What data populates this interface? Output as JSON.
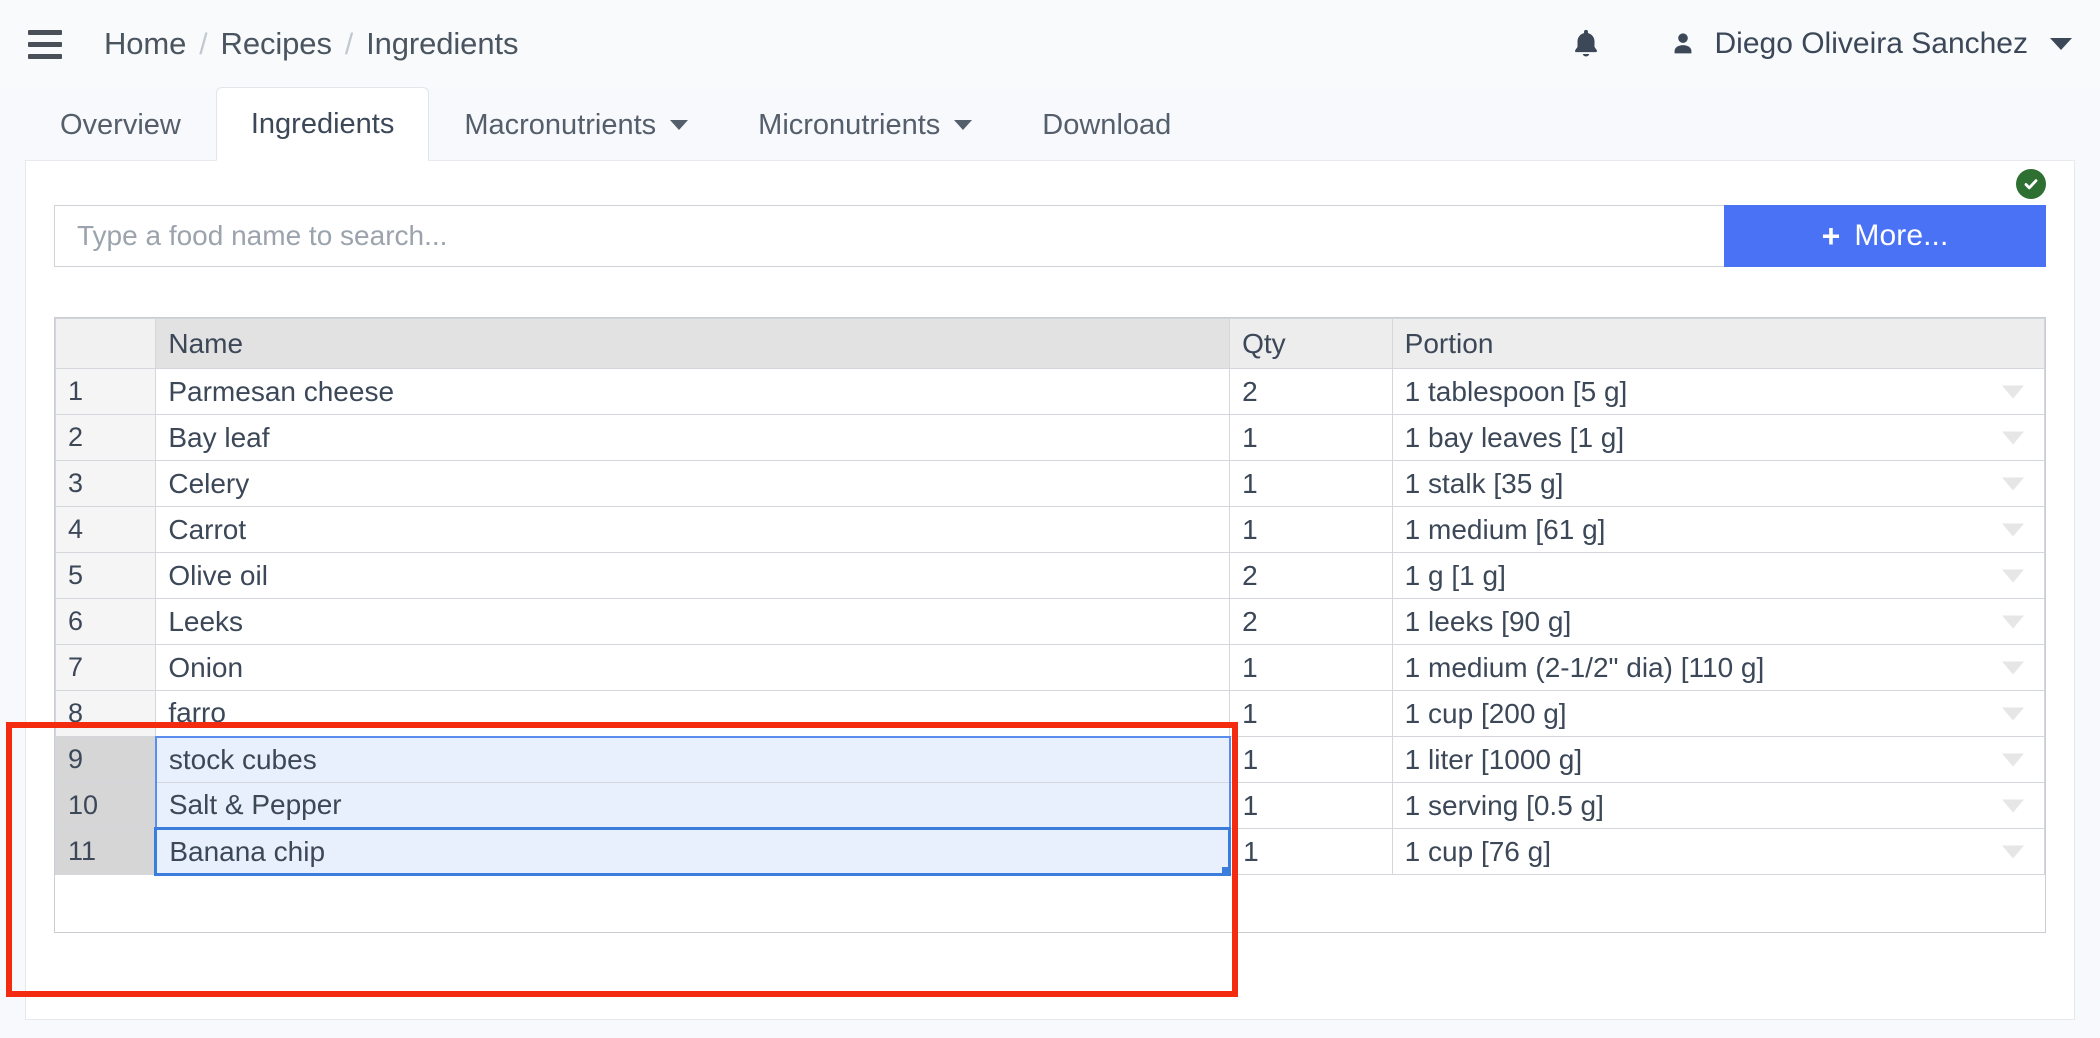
{
  "topbar": {
    "menu_icon": "hamburger-icon",
    "breadcrumb": [
      "Home",
      "Recipes",
      "Ingredients"
    ],
    "separator": "/",
    "notifications_icon": "bell-icon",
    "user_icon": "user-icon",
    "user_name": "Diego Oliveira Sanchez",
    "caret_icon": "chevron-down-icon"
  },
  "tabs": [
    {
      "label": "Overview",
      "active": false,
      "has_caret": false
    },
    {
      "label": "Ingredients",
      "active": true,
      "has_caret": false
    },
    {
      "label": "Macronutrients",
      "active": false,
      "has_caret": true
    },
    {
      "label": "Micronutrients",
      "active": false,
      "has_caret": true
    },
    {
      "label": "Download",
      "active": false,
      "has_caret": false
    }
  ],
  "status": {
    "icon": "check-circle-icon",
    "color": "#2e7031"
  },
  "search": {
    "placeholder": "Type a food name to search...",
    "value": "",
    "button_label": "More...",
    "button_plus": "+",
    "button_color": "#4a72f5"
  },
  "table": {
    "columns": [
      "",
      "Name",
      "Qty",
      "Portion"
    ],
    "rows": [
      {
        "idx": "1",
        "name": "Parmesan cheese",
        "qty": "2",
        "portion": "1 tablespoon [5 g]",
        "selected": false,
        "active": false
      },
      {
        "idx": "2",
        "name": "Bay leaf",
        "qty": "1",
        "portion": "1 bay leaves [1 g]",
        "selected": false,
        "active": false
      },
      {
        "idx": "3",
        "name": "Celery",
        "qty": "1",
        "portion": "1 stalk [35 g]",
        "selected": false,
        "active": false
      },
      {
        "idx": "4",
        "name": "Carrot",
        "qty": "1",
        "portion": "1 medium [61 g]",
        "selected": false,
        "active": false
      },
      {
        "idx": "5",
        "name": "Olive oil",
        "qty": "2",
        "portion": "1 g [1 g]",
        "selected": false,
        "active": false
      },
      {
        "idx": "6",
        "name": "Leeks",
        "qty": "2",
        "portion": "1 leeks [90 g]",
        "selected": false,
        "active": false
      },
      {
        "idx": "7",
        "name": "Onion",
        "qty": "1",
        "portion": "1 medium (2-1/2\" dia) [110 g]",
        "selected": false,
        "active": false
      },
      {
        "idx": "8",
        "name": "farro",
        "qty": "1",
        "portion": "1 cup [200 g]",
        "selected": false,
        "active": false
      },
      {
        "idx": "9",
        "name": "stock cubes",
        "qty": "1",
        "portion": "1 liter [1000 g]",
        "selected": true,
        "active": false
      },
      {
        "idx": "10",
        "name": "Salt & Pepper",
        "qty": "1",
        "portion": "1 serving [0.5 g]",
        "selected": true,
        "active": false
      },
      {
        "idx": "11",
        "name": "Banana chip",
        "qty": "1",
        "portion": "1 cup [76 g]",
        "selected": true,
        "active": true
      }
    ],
    "row_caret_icon": "chevron-down-icon",
    "selection_fill_color": "#e8f0fe",
    "selection_border_color": "#5b8def",
    "active_cell_border_color": "#3b7ddd"
  },
  "annotation": {
    "type": "highlight-rectangle",
    "color": "#f32c10"
  }
}
